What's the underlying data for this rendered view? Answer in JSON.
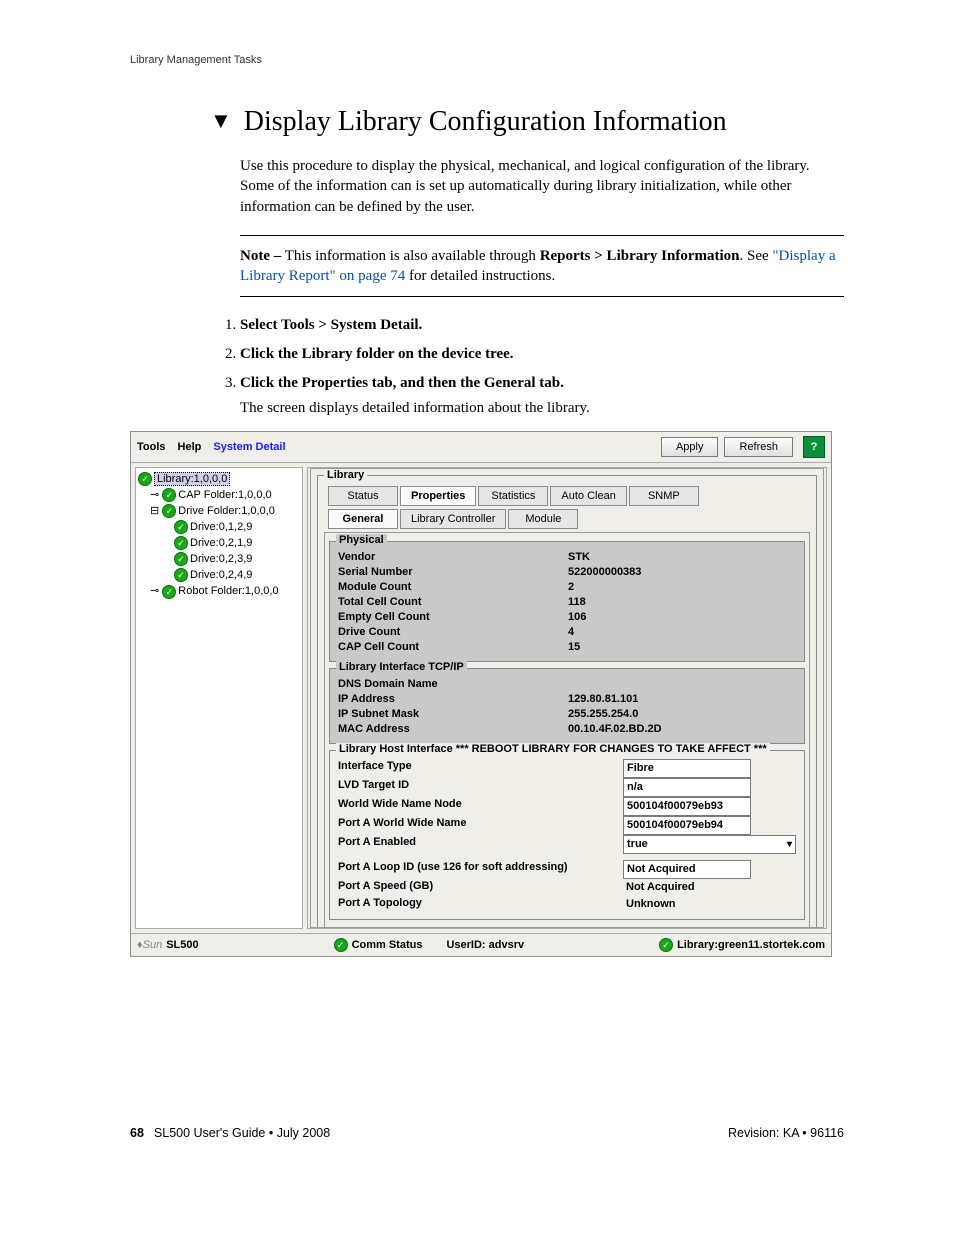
{
  "header": "Library Management Tasks",
  "title": "Display Library Configuration Information",
  "intro": "Use this procedure to display the physical, mechanical, and logical configuration of the library. Some of the information can is set up automatically during library initialization, while other information can be defined by the user.",
  "note_label": "Note –",
  "note_text_a": "This information is also available through ",
  "note_bold": "Reports > Library Information",
  "note_text_b": ". See ",
  "note_link": "\"Display a Library Report\" on page 74",
  "note_text_c": " for detailed instructions.",
  "steps": {
    "s1": "Select Tools > System Detail.",
    "s2": "Click the Library folder on the device tree.",
    "s3": "Click the Properties tab, and then the General tab.",
    "s3sub": "The screen displays detailed information about the library."
  },
  "menubar": {
    "tools": "Tools",
    "help": "Help",
    "system_detail": "System Detail",
    "apply": "Apply",
    "refresh": "Refresh"
  },
  "tree": {
    "root": "Library:1,0,0,0",
    "cap": "CAP Folder:1,0,0,0",
    "drivef": "Drive Folder:1,0,0,0",
    "d1": "Drive:0,1,2,9",
    "d2": "Drive:0,2,1,9",
    "d3": "Drive:0,2,3,9",
    "d4": "Drive:0,2,4,9",
    "robot": "Robot Folder:1,0,0,0"
  },
  "panel": {
    "library": "Library",
    "tabs1": {
      "status": "Status",
      "properties": "Properties",
      "statistics": "Statistics",
      "autoclean": "Auto Clean",
      "snmp": "SNMP"
    },
    "tabs2": {
      "general": "General",
      "controller": "Library Controller",
      "module": "Module"
    },
    "physical": {
      "legend": "Physical",
      "vendor_k": "Vendor",
      "vendor_v": "STK",
      "serial_k": "Serial Number",
      "serial_v": "522000000383",
      "module_k": "Module Count",
      "module_v": "2",
      "total_k": "Total Cell Count",
      "total_v": "118",
      "empty_k": "Empty Cell Count",
      "empty_v": "106",
      "drive_k": "Drive Count",
      "drive_v": "4",
      "cap_k": "CAP Cell Count",
      "cap_v": "15"
    },
    "tcpip": {
      "legend": "Library Interface TCP/IP",
      "dns_k": "DNS Domain Name",
      "dns_v": "",
      "ip_k": "IP Address",
      "ip_v": "129.80.81.101",
      "mask_k": "IP Subnet Mask",
      "mask_v": "255.255.254.0",
      "mac_k": "MAC Address",
      "mac_v": "00.10.4F.02.BD.2D"
    },
    "host": {
      "legend": "Library Host Interface *** REBOOT LIBRARY FOR CHANGES TO TAKE AFFECT ***",
      "itype_k": "Interface Type",
      "itype_v": "Fibre",
      "lvd_k": "LVD Target ID",
      "lvd_v": "n/a",
      "wwnn_k": "World Wide Name Node",
      "wwnn_v": "500104f00079eb93",
      "pawwn_k": "Port A World Wide Name",
      "pawwn_v": "500104f00079eb94",
      "pae_k": "Port A Enabled",
      "pae_v": "true",
      "paloop_k": "Port A Loop ID (use 126 for soft addressing)",
      "paloop_v": "Not Acquired",
      "paspeed_k": "Port A Speed (GB)",
      "paspeed_v": "Not Acquired",
      "patopo_k": "Port A Topology",
      "patopo_v": "Unknown"
    }
  },
  "status": {
    "brand": "Sun",
    "product": "SL500",
    "comm": "Comm Status",
    "user": "UserID: advsrv",
    "lib": "Library:green11.stortek.com"
  },
  "footer": {
    "page": "68",
    "guide": "SL500 User's Guide • July 2008",
    "rev": "Revision: KA • 96116"
  }
}
